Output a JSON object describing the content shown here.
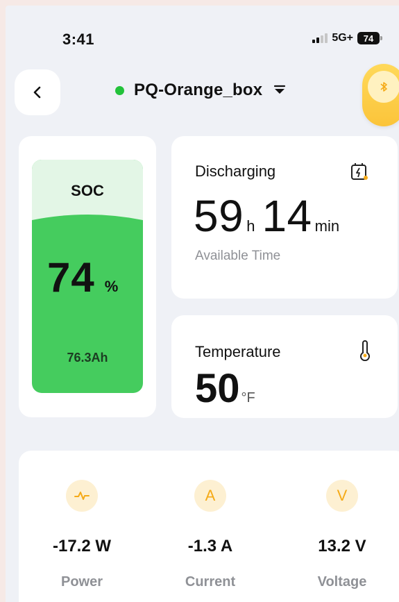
{
  "status_bar": {
    "time": "3:41",
    "network": "5G+",
    "battery": "74"
  },
  "header": {
    "device_name": "PQ-Orange_box",
    "connection_color": "#22c23a",
    "bluetooth_toggle_color": "#fbc43a"
  },
  "soc": {
    "label": "SOC",
    "value": "74",
    "unit": "%",
    "capacity": "76.3Ah",
    "fill_color": "#45cc5e"
  },
  "discharging": {
    "title": "Discharging",
    "hours": "59",
    "hours_unit": "h",
    "minutes": "14",
    "minutes_unit": "min",
    "subtitle": "Available Time"
  },
  "temperature": {
    "title": "Temperature",
    "value": "50",
    "unit": "°F"
  },
  "metrics": [
    {
      "icon": "pulse-icon",
      "value": "-17.2 W",
      "label": "Power"
    },
    {
      "icon": "A",
      "value": "-1.3 A",
      "label": "Current"
    },
    {
      "icon": "V",
      "value": "13.2 V",
      "label": "Voltage"
    }
  ]
}
